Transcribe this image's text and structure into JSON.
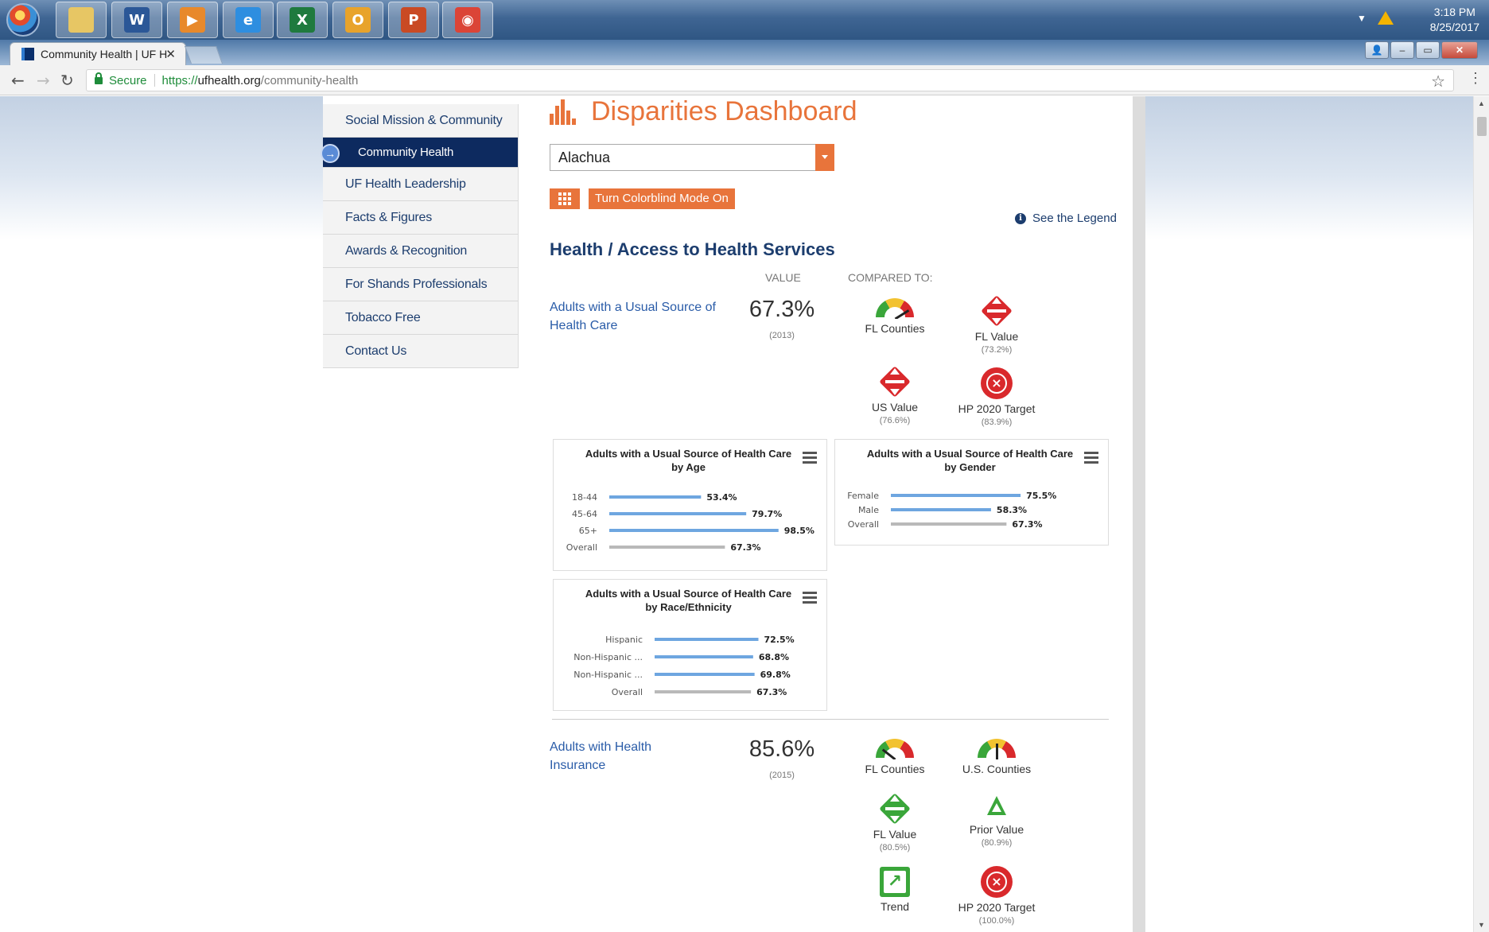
{
  "taskbar": {
    "apps": [
      {
        "name": "file-explorer-icon",
        "glyph": "",
        "color": "#e7c664"
      },
      {
        "name": "word-icon",
        "glyph": "W",
        "color": "#2b5797"
      },
      {
        "name": "media-player-icon",
        "glyph": "▶",
        "color": "#e8892b"
      },
      {
        "name": "internet-explorer-icon",
        "glyph": "e",
        "color": "#2e8ee0"
      },
      {
        "name": "excel-icon",
        "glyph": "X",
        "color": "#1f7a3e"
      },
      {
        "name": "outlook-icon",
        "glyph": "O",
        "color": "#e8a32b"
      },
      {
        "name": "powerpoint-icon",
        "glyph": "P",
        "color": "#c94a24"
      },
      {
        "name": "chrome-icon",
        "glyph": "◉",
        "color": "#db4437"
      }
    ],
    "time": "3:18 PM",
    "date": "8/25/2017"
  },
  "browser": {
    "tab_title": "Community Health | UF H",
    "secure_label": "Secure",
    "url_scheme": "https://",
    "url_host": "ufhealth.org",
    "url_path": "/community-health"
  },
  "sidebar": {
    "items": [
      {
        "label": "Social Mission & Community"
      },
      {
        "label": "Community Health",
        "active": true
      },
      {
        "label": "UF Health Leadership"
      },
      {
        "label": "Facts & Figures"
      },
      {
        "label": "Awards & Recognition"
      },
      {
        "label": "For Shands Professionals"
      },
      {
        "label": "Tobacco Free"
      },
      {
        "label": "Contact Us"
      }
    ]
  },
  "dashboard": {
    "title": "Disparities Dashboard",
    "county_select": "Alachua",
    "colorblind_button": "Turn Colorblind Mode On",
    "legend_link": "See the Legend",
    "section_title": "Health / Access to Health Services",
    "col_value": "VALUE",
    "col_compared": "COMPARED TO:",
    "indicators": [
      {
        "name": "Adults with a Usual Source of Health Care",
        "value": "67.3%",
        "year": "(2013)",
        "comparisons": [
          {
            "label": "FL Counties",
            "sub": "",
            "icon": "gauge-icon"
          },
          {
            "label": "FL Value",
            "sub": "(73.2%)",
            "icon": "diamond-red-icon"
          },
          {
            "label": "US Value",
            "sub": "(76.6%)",
            "icon": "diamond-red-icon"
          },
          {
            "label": "HP 2020 Target",
            "sub": "(83.9%)",
            "icon": "x-circle-icon"
          }
        ]
      },
      {
        "name": "Adults with Health Insurance",
        "value": "85.6%",
        "year": "(2015)",
        "comparisons": [
          {
            "label": "FL Counties",
            "sub": "",
            "icon": "gauge-icon"
          },
          {
            "label": "U.S. Counties",
            "sub": "",
            "icon": "gauge-icon"
          },
          {
            "label": "FL Value",
            "sub": "(80.5%)",
            "icon": "diamond-green-icon"
          },
          {
            "label": "Prior Value",
            "sub": "(80.9%)",
            "icon": "triangle-up-icon"
          },
          {
            "label": "Trend",
            "sub": "",
            "icon": "trend-icon"
          },
          {
            "label": "HP 2020 Target",
            "sub": "(100.0%)",
            "icon": "x-circle-icon"
          }
        ]
      }
    ]
  },
  "chart_data": [
    {
      "type": "bar",
      "title": "Adults with a Usual Source of Health Care by Age",
      "categories": [
        "18-44",
        "45-64",
        "65+",
        "Overall"
      ],
      "values": [
        53.4,
        79.7,
        98.5,
        67.3
      ],
      "value_labels": [
        "53.4%",
        "79.7%",
        "98.5%",
        "67.3%"
      ],
      "orientation": "horizontal",
      "xlim": [
        0,
        100
      ]
    },
    {
      "type": "bar",
      "title": "Adults with a Usual Source of Health Care by Gender",
      "categories": [
        "Female",
        "Male",
        "Overall"
      ],
      "values": [
        75.5,
        58.3,
        67.3
      ],
      "value_labels": [
        "75.5%",
        "58.3%",
        "67.3%"
      ],
      "orientation": "horizontal",
      "xlim": [
        0,
        100
      ]
    },
    {
      "type": "bar",
      "title": "Adults with a Usual Source of Health Care by Race/Ethnicity",
      "categories": [
        "Hispanic",
        "Non-Hispanic ...",
        "Non-Hispanic ...",
        "Overall"
      ],
      "values": [
        72.5,
        68.8,
        69.8,
        67.3
      ],
      "value_labels": [
        "72.5%",
        "68.8%",
        "69.8%",
        "67.3%"
      ],
      "orientation": "horizontal",
      "xlim": [
        0,
        100
      ]
    }
  ],
  "colors": {
    "brand_navy": "#0d2a5f",
    "accent_orange": "#e8743b",
    "bar_blue": "#6ea6e0",
    "bar_overall": "#b9b9b9",
    "good_green": "#3aa63a",
    "bad_red": "#d9292c"
  }
}
